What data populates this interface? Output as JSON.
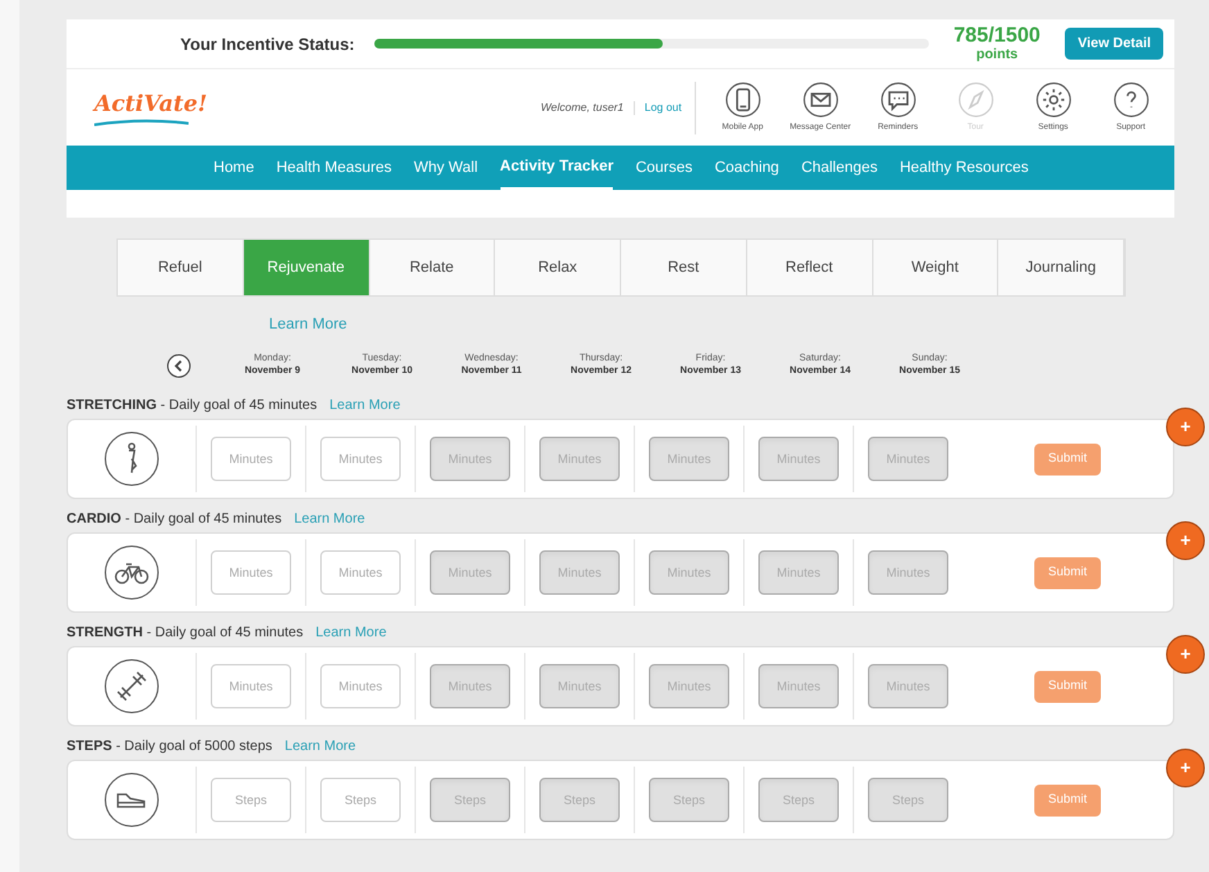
{
  "incentive": {
    "label": "Your Incentive Status:",
    "level": 0.52,
    "points": "785/1500",
    "points_unit": "points",
    "button": "View Detail"
  },
  "header": {
    "logo": "ActiVate!",
    "welcome": "Welcome, tuser1",
    "logout": "Log out",
    "tools": [
      {
        "kind": "phone",
        "label": "Mobile App",
        "disabled": false
      },
      {
        "kind": "mail",
        "label": "Message Center",
        "disabled": false
      },
      {
        "kind": "chat",
        "label": "Reminders",
        "disabled": false
      },
      {
        "kind": "compass",
        "label": "Tour",
        "disabled": true
      },
      {
        "kind": "gear",
        "label": "Settings",
        "disabled": false
      },
      {
        "kind": "help",
        "label": "Support",
        "disabled": false
      }
    ]
  },
  "nav": [
    {
      "label": "Home",
      "selected": false
    },
    {
      "label": "Health Measures",
      "selected": false
    },
    {
      "label": "Why Wall",
      "selected": false
    },
    {
      "label": "Activity Tracker",
      "selected": true
    },
    {
      "label": "Courses",
      "selected": false
    },
    {
      "label": "Coaching",
      "selected": false
    },
    {
      "label": "Challenges",
      "selected": false
    },
    {
      "label": "Healthy Resources",
      "selected": false
    }
  ],
  "tabs": [
    {
      "label": "Refuel",
      "selected": false
    },
    {
      "label": "Rejuvenate",
      "selected": true
    },
    {
      "label": "Relate",
      "selected": false
    },
    {
      "label": "Relax",
      "selected": false
    },
    {
      "label": "Rest",
      "selected": false
    },
    {
      "label": "Reflect",
      "selected": false
    },
    {
      "label": "Weight",
      "selected": false
    },
    {
      "label": "Journaling",
      "selected": false
    }
  ],
  "tab_link": "Learn More",
  "days": [
    {
      "day": "Monday:",
      "date": "November 9"
    },
    {
      "day": "Tuesday:",
      "date": "November 10"
    },
    {
      "day": "Wednesday:",
      "date": "November 11"
    },
    {
      "day": "Thursday:",
      "date": "November 12"
    },
    {
      "day": "Friday:",
      "date": "November 13"
    },
    {
      "day": "Saturday:",
      "date": "November 14"
    },
    {
      "day": "Sunday:",
      "date": "November 15"
    }
  ],
  "activities": [
    {
      "kind": "stretch",
      "name": "STRETCHING",
      "goal": " - Daily goal of 45 minutes",
      "link": "Learn More",
      "submit": "Submit",
      "add": "+",
      "fields": [
        {
          "placeholder": "Minutes",
          "disabled": false
        },
        {
          "placeholder": "Minutes",
          "disabled": false
        },
        {
          "placeholder": "Minutes",
          "disabled": true
        },
        {
          "placeholder": "Minutes",
          "disabled": true
        },
        {
          "placeholder": "Minutes",
          "disabled": true
        },
        {
          "placeholder": "Minutes",
          "disabled": true
        },
        {
          "placeholder": "Minutes",
          "disabled": true
        }
      ]
    },
    {
      "kind": "bike",
      "name": "CARDIO",
      "goal": " - Daily goal of 45 minutes",
      "link": "Learn More",
      "submit": "Submit",
      "add": "+",
      "fields": [
        {
          "placeholder": "Minutes",
          "disabled": false
        },
        {
          "placeholder": "Minutes",
          "disabled": false
        },
        {
          "placeholder": "Minutes",
          "disabled": true
        },
        {
          "placeholder": "Minutes",
          "disabled": true
        },
        {
          "placeholder": "Minutes",
          "disabled": true
        },
        {
          "placeholder": "Minutes",
          "disabled": true
        },
        {
          "placeholder": "Minutes",
          "disabled": true
        }
      ]
    },
    {
      "kind": "dumbbell",
      "name": "STRENGTH",
      "goal": " - Daily goal of 45 minutes",
      "link": "Learn More",
      "submit": "Submit",
      "add": "+",
      "fields": [
        {
          "placeholder": "Minutes",
          "disabled": false
        },
        {
          "placeholder": "Minutes",
          "disabled": false
        },
        {
          "placeholder": "Minutes",
          "disabled": true
        },
        {
          "placeholder": "Minutes",
          "disabled": true
        },
        {
          "placeholder": "Minutes",
          "disabled": true
        },
        {
          "placeholder": "Minutes",
          "disabled": true
        },
        {
          "placeholder": "Minutes",
          "disabled": true
        }
      ]
    },
    {
      "kind": "shoe",
      "name": "STEPS",
      "goal": " - Daily goal of 5000 steps",
      "link": "Learn More",
      "submit": "Submit",
      "add": "+",
      "fields": [
        {
          "placeholder": "Steps",
          "disabled": false
        },
        {
          "placeholder": "Steps",
          "disabled": false
        },
        {
          "placeholder": "Steps",
          "disabled": true
        },
        {
          "placeholder": "Steps",
          "disabled": true
        },
        {
          "placeholder": "Steps",
          "disabled": true
        },
        {
          "placeholder": "Steps",
          "disabled": true
        },
        {
          "placeholder": "Steps",
          "disabled": true
        }
      ]
    }
  ]
}
